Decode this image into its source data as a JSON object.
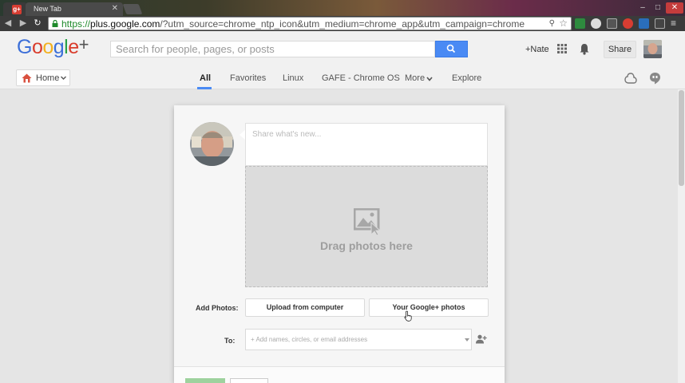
{
  "browser": {
    "tabs": [
      {
        "title": "",
        "icon": "gplus-favicon"
      },
      {
        "title": "New Tab"
      }
    ],
    "url": {
      "scheme": "https://",
      "host": "plus.google.com",
      "rest": "/?utm_source=chrome_ntp_icon&utm_medium=chrome_app&utm_campaign=chrome"
    },
    "favicon_letter": "g+"
  },
  "header": {
    "logo": {
      "g1": "G",
      "o1": "o",
      "o2": "o",
      "g2": "g",
      "l": "l",
      "e": "e",
      "plus": "+"
    },
    "search_placeholder": "Search for people, pages, or posts",
    "user_name": "+Nate",
    "share_label": "Share"
  },
  "nav": {
    "home_label": "Home",
    "tabs": [
      {
        "label": "All",
        "active": true
      },
      {
        "label": "Favorites"
      },
      {
        "label": "Linux"
      },
      {
        "label": "GAFE - Chrome OS"
      },
      {
        "label": "More"
      },
      {
        "label": "Explore"
      }
    ],
    "accent_color": "#4a8af4"
  },
  "share_box": {
    "text_placeholder": "Share what's new...",
    "drop_label": "Drag photos here",
    "add_photos_label": "Add Photos:",
    "upload_label": "Upload from computer",
    "gplus_photos_label": "Your Google+ photos",
    "to_label": "To:",
    "to_placeholder": "+ Add names, circles, or email addresses"
  }
}
